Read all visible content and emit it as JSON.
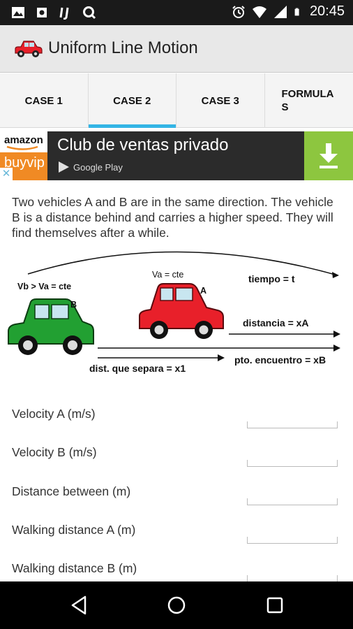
{
  "status_bar": {
    "time": "20:45",
    "left_icons": [
      "image-icon",
      "gear-icon",
      "ij-icon",
      "q-icon"
    ],
    "right_icons": [
      "alarm-icon",
      "wifi-icon",
      "signal-icon",
      "battery-icon"
    ]
  },
  "app": {
    "title": "Uniform Line Motion",
    "logo_icon": "red-car-icon"
  },
  "tabs": [
    {
      "label": "CASE 1",
      "active": false
    },
    {
      "label": "CASE 2",
      "active": true
    },
    {
      "label": "CASE 3",
      "active": false
    },
    {
      "label": "FORMULAS",
      "active": false
    }
  ],
  "ad": {
    "brand_top": "amazon",
    "brand_bottom": "buyvip",
    "headline": "Club de ventas privado",
    "store": "Google Play",
    "close": "✕",
    "colors": {
      "background": "#2b2b2b",
      "download": "#8dc63f",
      "buyvip": "#f08a24"
    }
  },
  "intro_text": "Two vehicles A and B are in the same direction. The vehicle B is a distance behind and carries a higher speed. They will find themselves after a while.",
  "diagram": {
    "label_vb": "Vb > Va = cte",
    "label_va": "Va = cte",
    "label_b": "B",
    "label_a": "A",
    "label_tiempo": "tiempo = t",
    "label_distancia": "distancia = xA",
    "label_separa": "dist. que separa = x1",
    "label_encuentro": "pto. encuentro = xB",
    "colors": {
      "car_a": "#e8202a",
      "car_b": "#22a032"
    }
  },
  "fields": [
    {
      "label": "Velocity A (m/s)",
      "value": ""
    },
    {
      "label": "Velocity B (m/s)",
      "value": ""
    },
    {
      "label": "Distance between (m)",
      "value": ""
    },
    {
      "label": "Walking distance A (m)",
      "value": ""
    },
    {
      "label": "Walking distance B (m)",
      "value": ""
    }
  ],
  "nav": [
    "back-icon",
    "home-icon",
    "recents-icon"
  ],
  "accent_color": "#33b5e5"
}
